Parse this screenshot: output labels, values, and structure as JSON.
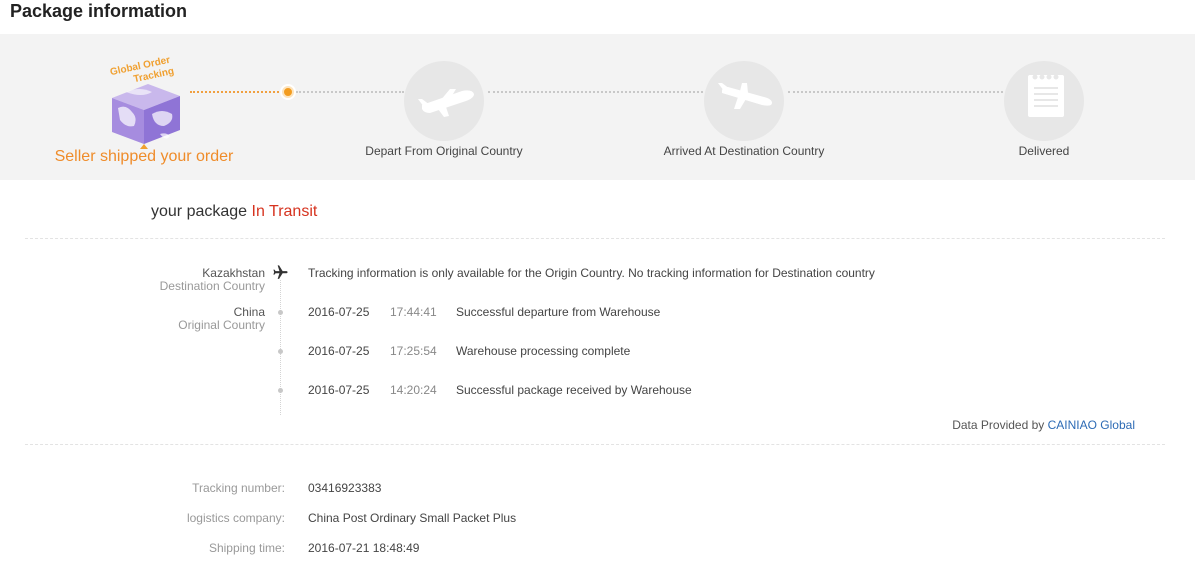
{
  "header": {
    "title": "Package information"
  },
  "progress": {
    "box_badge": "Global Order Tracking",
    "steps": [
      {
        "label": "Seller shipped your order",
        "icon": "package-box-icon",
        "active": true
      },
      {
        "label": "Depart From Original Country",
        "icon": "airplane-depart-icon",
        "active": false
      },
      {
        "label": "Arrived At Destination Country",
        "icon": "airplane-arrive-icon",
        "active": false
      },
      {
        "label": "Delivered",
        "icon": "document-delivered-icon",
        "active": false
      }
    ],
    "colors": {
      "active": "#ef8c2a",
      "inactive": "#c8c8c8"
    }
  },
  "status": {
    "prefix": "your package",
    "value": "In Transit",
    "color": "#d6331f"
  },
  "countries": {
    "destination": {
      "name": "Kazakhstan",
      "role": "Destination Country"
    },
    "origin": {
      "name": "China",
      "role": "Original Country"
    }
  },
  "events": [
    {
      "text": "Tracking information is only available for the Origin Country. No tracking information for Destination country"
    },
    {
      "date": "2016-07-25",
      "time": "17:44:41",
      "text": "Successful departure from Warehouse"
    },
    {
      "date": "2016-07-25",
      "time": "17:25:54",
      "text": "Warehouse processing complete"
    },
    {
      "date": "2016-07-25",
      "time": "14:20:24",
      "text": "Successful package received by Warehouse"
    }
  ],
  "provider": {
    "prefix": "Data Provided by",
    "name": "CAINIAO Global"
  },
  "info": {
    "tracking_label": "Tracking number:",
    "tracking_value": "03416923383",
    "company_label": "logistics company:",
    "company_value": "China Post Ordinary Small Packet Plus",
    "shipping_label": "Shipping time:",
    "shipping_value": "2016-07-21 18:48:49"
  }
}
